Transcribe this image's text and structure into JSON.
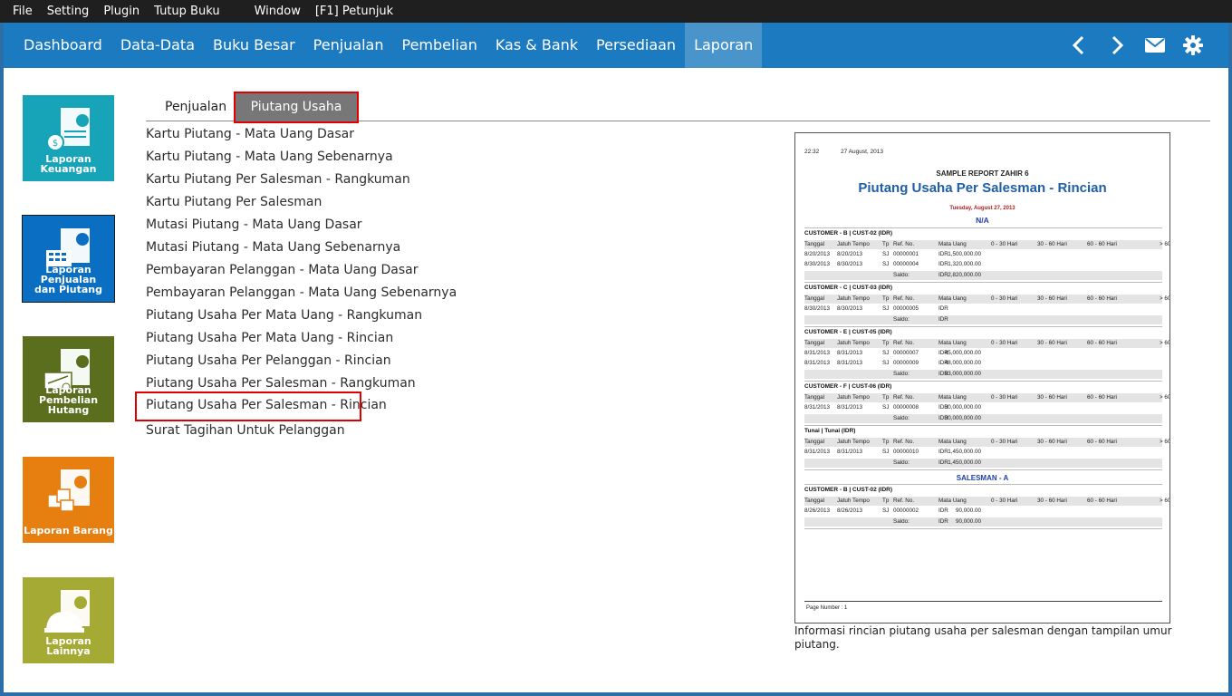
{
  "menubar": {
    "items": [
      "File",
      "Setting",
      "Plugin",
      "Tutup Buku",
      "Window",
      "[F1] Petunjuk"
    ]
  },
  "nav": {
    "tabs": [
      "Dashboard",
      "Data-Data",
      "Buku Besar",
      "Penjualan",
      "Pembelian",
      "Kas & Bank",
      "Persediaan",
      "Laporan"
    ],
    "active": "Laporan",
    "icons": [
      "chevron-left-icon",
      "chevron-right-icon",
      "mail-icon",
      "gear-icon"
    ]
  },
  "tiles": [
    {
      "label1": "Laporan",
      "label2": "Keuangan",
      "color": "#17a3b8"
    },
    {
      "label1": "Laporan Penjualan",
      "label2": "dan Piutang",
      "color": "#0a6fc2"
    },
    {
      "label1": "Laporan",
      "label2": "Pembelian Hutang",
      "color": "#5a6e1e"
    },
    {
      "label1": "",
      "label2": "Laporan Barang",
      "color": "#e67e10"
    },
    {
      "label1": "",
      "label2": "Laporan Lainnya",
      "color": "#a5aa34"
    }
  ],
  "subtabs": {
    "tab1": "Penjualan",
    "tab2": "Piutang Usaha"
  },
  "reports": [
    "Kartu Piutang - Mata Uang Dasar",
    "Kartu Piutang - Mata Uang Sebenarnya",
    "Kartu Piutang Per Salesman - Rangkuman",
    "Kartu Piutang Per Salesman",
    "Mutasi Piutang - Mata Uang Dasar",
    "Mutasi Piutang - Mata Uang Sebenarnya",
    "Pembayaran Pelanggan - Mata Uang Dasar",
    "Pembayaran Pelanggan - Mata Uang Sebenarnya",
    "Piutang Usaha Per Mata Uang - Rangkuman",
    "Piutang Usaha Per Mata Uang - Rincian",
    "Piutang Usaha Per Pelanggan - Rincian",
    "Piutang Usaha Per Salesman - Rangkuman",
    "Piutang Usaha Per Salesman - Rincian",
    "Surat Tagihan Untuk Pelanggan"
  ],
  "preview": {
    "time": "22:32",
    "date": "27 August, 2013",
    "company": "SAMPLE REPORT ZAHIR 6",
    "title": "Piutang Usaha Per Salesman - Rincian",
    "subdate": "Tuesday, August 27, 2013",
    "salesman1": "N/A",
    "salesman2": "SALESMAN - A",
    "headers": [
      "Tanggal",
      "Jatuh Tempo",
      "Tp",
      "Ref. No.",
      "Mata Uang",
      "0 - 30 Hari",
      "30 - 60 Hari",
      "60 - 60 Hari",
      "> 60 Hari"
    ],
    "saldo_label": "Saldo:",
    "groups": [
      {
        "customer": "CUSTOMER - B | CUST-02 (IDR)",
        "rows": [
          [
            "8/20/2013",
            "8/20/2013",
            "SJ",
            "00000001",
            "IDR",
            "1,500,000.00"
          ],
          [
            "8/30/2013",
            "8/30/2013",
            "SJ",
            "00000004",
            "IDR",
            "1,320,000.00"
          ]
        ],
        "saldo": "2,820,000.00"
      },
      {
        "customer": "CUSTOMER - C | CUST-03 (IDR)",
        "rows": [
          [
            "8/30/2013",
            "8/30/2013",
            "SJ",
            "00000005",
            "IDR",
            ""
          ]
        ],
        "saldo": ""
      },
      {
        "customer": "CUSTOMER - E | CUST-05 (IDR)",
        "rows": [
          [
            "8/31/2013",
            "8/31/2013",
            "SJ",
            "00000007",
            "IDR",
            "45,000,000.00"
          ],
          [
            "8/31/2013",
            "8/31/2013",
            "SJ",
            "00000009",
            "IDR",
            "48,000,000.00"
          ]
        ],
        "saldo": "93,000,000.00"
      },
      {
        "customer": "CUSTOMER - F | CUST-06 (IDR)",
        "rows": [
          [
            "8/31/2013",
            "8/31/2013",
            "SJ",
            "00000008",
            "IDR",
            "30,000,000.00"
          ]
        ],
        "saldo": "30,000,000.00"
      },
      {
        "customer": "Tunai | Tunai (IDR)",
        "rows": [
          [
            "8/31/2013",
            "8/31/2013",
            "SJ",
            "00000010",
            "IDR",
            "1,450,000.00"
          ]
        ],
        "saldo": "1,450,000.00"
      },
      {
        "customer": "CUSTOMER - B | CUST-02 (IDR)",
        "rows": [
          [
            "8/26/2013",
            "8/26/2013",
            "SJ",
            "00000002",
            "IDR",
            "90,000.00"
          ]
        ],
        "saldo": "90,000.00"
      }
    ],
    "footer": "Page Number : 1",
    "currency": "IDR"
  },
  "description": "Informasi rincian piutang usaha per salesman dengan tampilan umur piutang."
}
